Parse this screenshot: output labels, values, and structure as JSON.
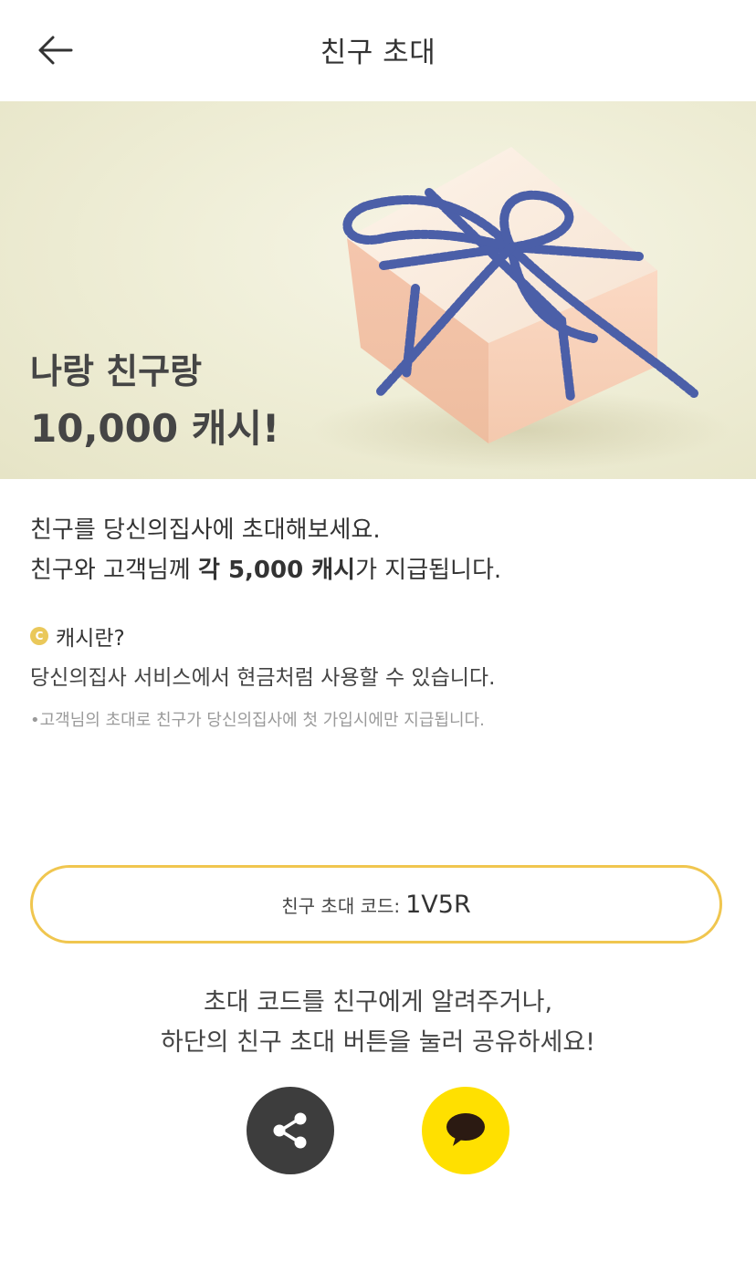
{
  "header": {
    "title": "친구 초대",
    "back_icon": "arrow-left-icon"
  },
  "hero": {
    "line1": "나랑 친구랑",
    "line2": "10,000 캐시!"
  },
  "description": {
    "line1": "친구를 당신의집사에 초대해보세요.",
    "line2_pre": "친구와 고객님께 ",
    "line2_bold": "각 5,000 캐시",
    "line2_post": "가 지급됩니다."
  },
  "cash_info": {
    "icon_letter": "C",
    "title": "캐시란?",
    "desc": "당신의집사 서비스에서 현금처럼 사용할 수 있습니다.",
    "note": "•고객님의 초대로 친구가 당신의집사에 첫 가입시에만 지급됩니다."
  },
  "invite_code": {
    "label": "친구 초대 코드:",
    "value": "1V5R"
  },
  "share": {
    "line1": "초대 코드를 친구에게 알려주거나,",
    "line2": "하단의 친구 초대 버튼을 눌러 공유하세요!",
    "share_icon": "share-icon",
    "kakao_icon": "kakaotalk-icon"
  },
  "colors": {
    "accent_border": "#f0c64f",
    "share_button": "#3d3d3d",
    "kakao_button": "#ffe000"
  }
}
